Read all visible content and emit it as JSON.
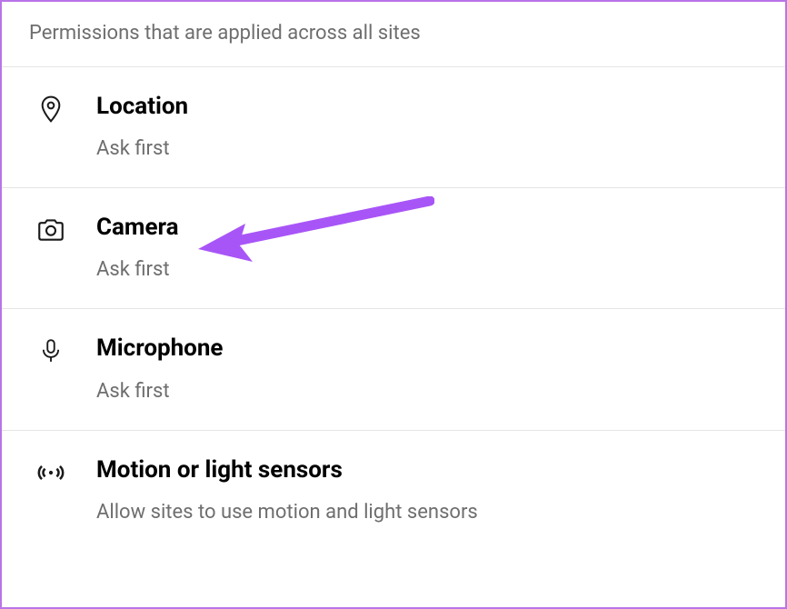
{
  "header": {
    "description": "Permissions that are applied across all sites"
  },
  "permissions": [
    {
      "icon": "location-icon",
      "title": "Location",
      "subtitle": "Ask first"
    },
    {
      "icon": "camera-icon",
      "title": "Camera",
      "subtitle": "Ask first"
    },
    {
      "icon": "microphone-icon",
      "title": "Microphone",
      "subtitle": "Ask first"
    },
    {
      "icon": "motion-sensor-icon",
      "title": "Motion or light sensors",
      "subtitle": "Allow sites to use motion and light sensors"
    }
  ],
  "annotation": {
    "color": "#a855f7"
  }
}
